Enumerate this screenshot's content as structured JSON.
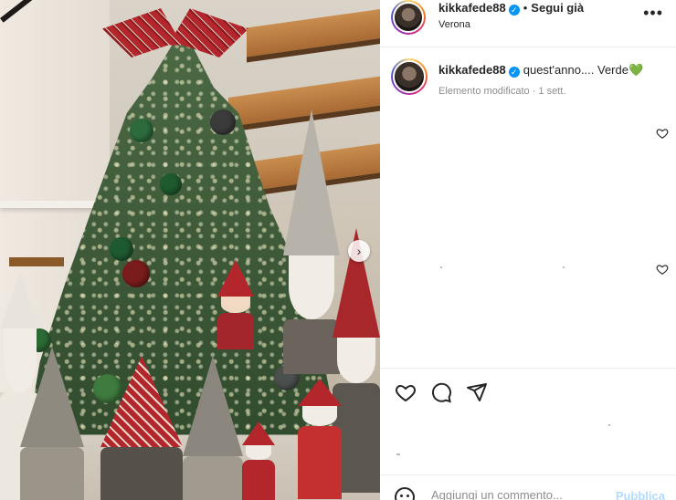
{
  "post": {
    "username": "kikkafede88",
    "verified_icon": "verified-badge-icon",
    "follow_status": "Segui già",
    "location": "Verona",
    "more_icon": "more-options-icon",
    "more_label": "•••"
  },
  "caption": {
    "username": "kikkafede88",
    "text": "quest'anno.... Verde",
    "emoji": "💚",
    "meta": "Elemento modificato · 1 sett."
  },
  "media": {
    "next_icon": "chevron-right-icon",
    "next_label": "›"
  },
  "actions": {
    "like_icon": "heart-outline-icon",
    "comment_icon": "comment-bubble-icon",
    "share_icon": "send-paper-plane-icon"
  },
  "comment_bar": {
    "emoji_icon": "emoji-smiley-icon",
    "placeholder": "Aggiungi un commento...",
    "publish_label": "Pubblica"
  },
  "colors": {
    "accent": "#0095f6",
    "publish_disabled": "#b3dbff",
    "heart_green": "#2fbf3a"
  }
}
